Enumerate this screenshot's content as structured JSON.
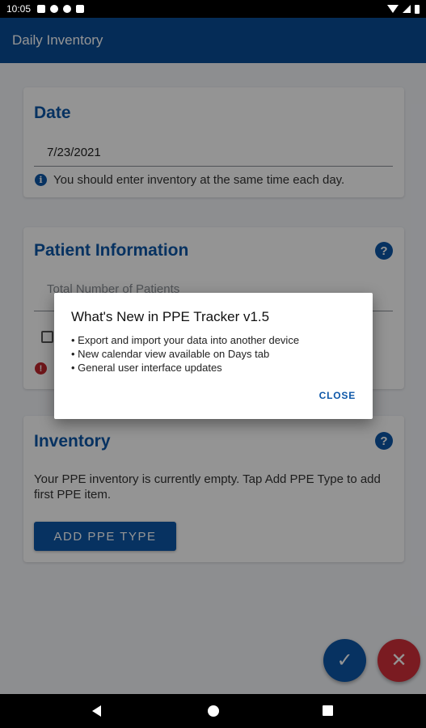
{
  "status_bar": {
    "time": "10:05"
  },
  "app_bar": {
    "title": "Daily Inventory"
  },
  "date_card": {
    "title": "Date",
    "value": "7/23/2021",
    "hint": "You should enter inventory at the same time each day."
  },
  "patient_card": {
    "title": "Patient Information",
    "placeholder": "Total Number of Patients"
  },
  "inventory_card": {
    "title": "Inventory",
    "empty_text": "Your PPE inventory is currently empty. Tap Add PPE Type to add first PPE item.",
    "add_button": "ADD PPE TYPE"
  },
  "dialog": {
    "title": "What's New in PPE Tracker v1.5",
    "items": [
      "Export and import your data into another device",
      "New calendar view available on Days tab",
      "General user interface updates"
    ],
    "close_label": "CLOSE"
  },
  "icons": {
    "help": "?",
    "info": "i",
    "error": "!",
    "check": "✓",
    "close": "✕"
  }
}
